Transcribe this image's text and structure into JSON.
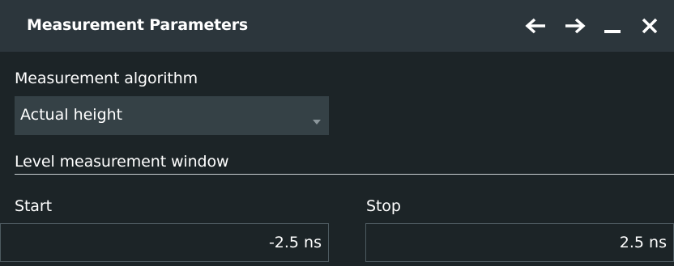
{
  "dialog": {
    "title": "Measurement Parameters",
    "buttons": {
      "back_icon": "arrow-left-icon",
      "forward_icon": "arrow-right-icon",
      "minimize_icon": "minimize-icon",
      "close_icon": "close-icon"
    }
  },
  "algorithm": {
    "label": "Measurement algorithm",
    "selected": "Actual height"
  },
  "level_window": {
    "heading": "Level measurement window",
    "start": {
      "label": "Start",
      "value": "-2.5 ns"
    },
    "stop": {
      "label": "Stop",
      "value": "2.5 ns"
    }
  },
  "colors": {
    "background": "#1c2427",
    "titlebar": "#2c363c",
    "dropdown": "#354146",
    "field_border": "#4d5a60",
    "text": "#ffffff"
  }
}
